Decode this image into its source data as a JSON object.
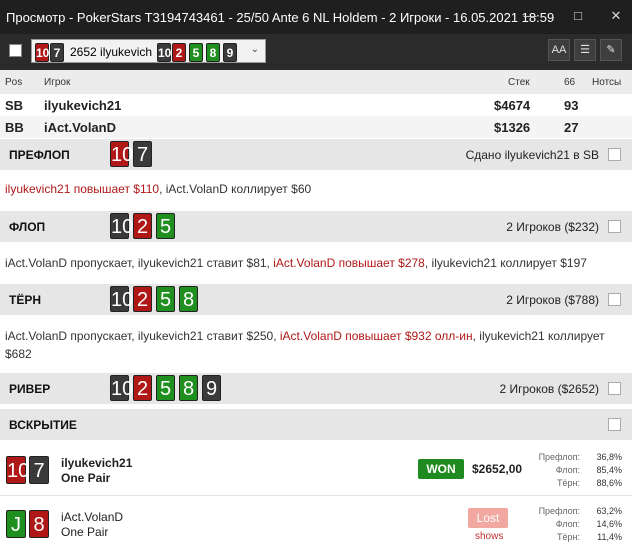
{
  "window": {
    "title": "Просмотр - PokerStars T3194743461 - 25/50 Ante 6 NL Holdem - 2 Игроки - 16.05.2021 18:59",
    "minimize": "—",
    "maximize": "□",
    "close": "✕"
  },
  "toolbar": {
    "hand_label": "2652 ilyukevich",
    "hand_hole_cards": [
      "10",
      "7"
    ],
    "hand_board_cards": [
      "10",
      "2",
      "5",
      "8",
      "9"
    ],
    "font_button": "AA",
    "list_button": "list-icon",
    "edit_button": "pencil-icon"
  },
  "columns": {
    "pos": "Pos",
    "player": "Игрок",
    "stack": "Стек",
    "sixtysix": "66",
    "notes": "Нотсы"
  },
  "players": [
    {
      "pos": "SB",
      "name": "ilyukevich21",
      "stack": "$4674",
      "score": "93"
    },
    {
      "pos": "BB",
      "name": "iAct.VolanD",
      "stack": "$1326",
      "score": "27"
    }
  ],
  "streets": [
    {
      "name": "ПРЕФЛОП",
      "cards": [
        "10",
        "7"
      ],
      "info": "Сдано ilyukevich21 в SB",
      "action": [
        {
          "text": "ilyukevich21 повышает $110",
          "hl": true
        },
        {
          "text": ", iAct.VolanD коллирует $60",
          "hl": false
        }
      ]
    },
    {
      "name": "ФЛОП",
      "cards": [
        "10",
        "2",
        "5"
      ],
      "info": "2 Игроков ($232)",
      "action": [
        {
          "text": "iAct.VolanD пропускает, ilyukevich21 ставит $81, ",
          "hl": false
        },
        {
          "text": "iAct.VolanD повышает $278",
          "hl": true
        },
        {
          "text": ", ilyukevich21 коллирует $197",
          "hl": false
        }
      ]
    },
    {
      "name": "ТЁРН",
      "cards": [
        "10",
        "2",
        "5",
        "8"
      ],
      "info": "2 Игроков ($788)",
      "action": [
        {
          "text": "iAct.VolanD пропускает, ilyukevich21 ставит $250, ",
          "hl": false
        },
        {
          "text": "iAct.VolanD повышает $932 олл-ин",
          "hl": true
        },
        {
          "text": ", ilyukevich21 коллирует $682",
          "hl": false
        }
      ]
    },
    {
      "name": "РИВЕР",
      "cards": [
        "10",
        "2",
        "5",
        "8",
        "9"
      ],
      "info": "2 Игроков ($2652)",
      "action": []
    }
  ],
  "showdown": {
    "title": "ВСКРЫТИЕ",
    "results": [
      {
        "cards": [
          "10",
          "7"
        ],
        "name": "ilyukevich21",
        "hand": "One Pair",
        "badge": "WON",
        "amount": "$2652,00",
        "stats": [
          {
            "label": "Префлоп:",
            "value": "36,8%"
          },
          {
            "label": "Флоп:",
            "value": "85,4%"
          },
          {
            "label": "Тёрн:",
            "value": "88,6%"
          }
        ]
      },
      {
        "cards": [
          "J",
          "8"
        ],
        "name": "iAct.VolanD",
        "hand": "One Pair",
        "badge": "Lost",
        "sub": "shows",
        "stats": [
          {
            "label": "Префлоп:",
            "value": "63,2%"
          },
          {
            "label": "Флоп:",
            "value": "14,6%"
          },
          {
            "label": "Тёрн:",
            "value": "11,4%"
          }
        ]
      }
    ]
  },
  "colors": {
    "red_card": "#b01818",
    "black_card": "#3a3a3a",
    "green_card": "#1f8f1f",
    "highlight_text": "#b01818",
    "won": "#1f8a1f",
    "lost": "#f0a8a0"
  }
}
